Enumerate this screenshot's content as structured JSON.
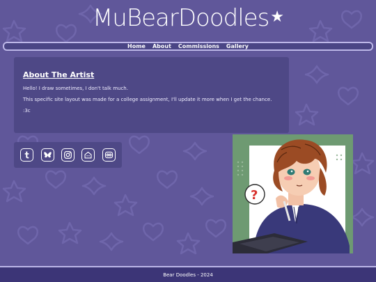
{
  "site": {
    "title": "MuBearDoodles"
  },
  "nav": {
    "items": [
      {
        "label": "Home"
      },
      {
        "label": "About"
      },
      {
        "label": "Commissions"
      },
      {
        "label": "Gallery"
      }
    ]
  },
  "about": {
    "heading": "About The Artist",
    "paragraphs": [
      "Hello! I draw sometimes, I don't talk much.",
      "This specific site layout was made for a college assignment, I'll update it more when I get the chance.",
      ":3c"
    ]
  },
  "socials": [
    {
      "icon": "tumblr-icon"
    },
    {
      "icon": "bluesky-icon"
    },
    {
      "icon": "instagram-icon"
    },
    {
      "icon": "cohost-icon"
    },
    {
      "icon": "toyhouse-icon"
    }
  ],
  "artwork": {
    "speech_bubble": "?"
  },
  "footer": {
    "text": "Bear Doodles - 2024"
  },
  "colors": {
    "background": "#60579a",
    "card": "#4e4886",
    "nav_border": "#bdb7e8",
    "footer": "#3c3577"
  }
}
